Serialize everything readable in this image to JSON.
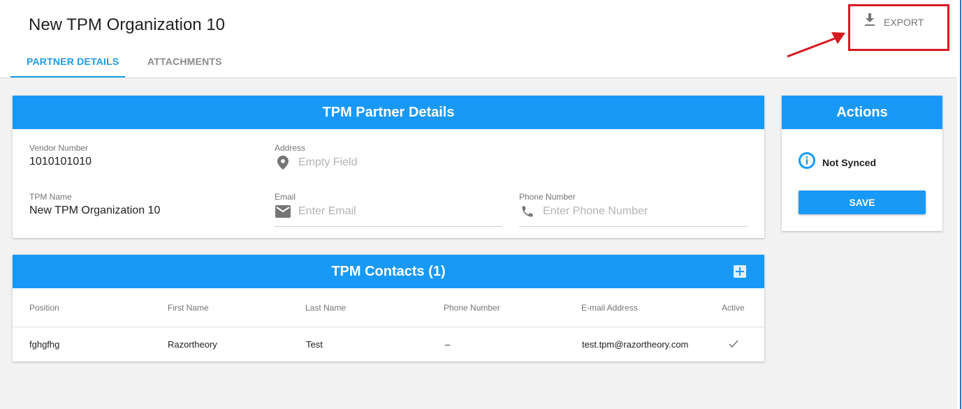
{
  "header": {
    "title": "New TPM Organization 10",
    "tabs": [
      {
        "label": "PARTNER DETAILS",
        "active": true
      },
      {
        "label": "ATTACHMENTS",
        "active": false
      }
    ],
    "export_label": "EXPORT"
  },
  "partner_details": {
    "title": "TPM Partner Details",
    "vendor_number": {
      "label": "Vendor Number",
      "value": "1010101010"
    },
    "address": {
      "label": "Address",
      "placeholder": "Empty Field"
    },
    "tpm_name": {
      "label": "TPM Name",
      "value": "New TPM Organization 10"
    },
    "email": {
      "label": "Email",
      "placeholder": "Enter Email"
    },
    "phone": {
      "label": "Phone Number",
      "placeholder": "Enter Phone Number"
    }
  },
  "contacts": {
    "title": "TPM Contacts (1)",
    "columns": [
      "Position",
      "First Name",
      "Last Name",
      "Phone Number",
      "E-mail Address",
      "Active"
    ],
    "rows": [
      {
        "position": "fghgfhg",
        "first_name": "Razortheory",
        "last_name": "Test",
        "phone": "–",
        "email": "test.tpm@razortheory.com",
        "active": true
      }
    ]
  },
  "actions": {
    "title": "Actions",
    "status": "Not Synced",
    "save_label": "SAVE"
  },
  "colors": {
    "accent": "#1899f8",
    "tab_active": "#1e9be6",
    "annotation": "#d71920"
  },
  "icons": [
    "download-icon",
    "location-pin-icon",
    "mail-icon",
    "phone-icon",
    "add-box-icon",
    "info-icon",
    "check-icon"
  ]
}
